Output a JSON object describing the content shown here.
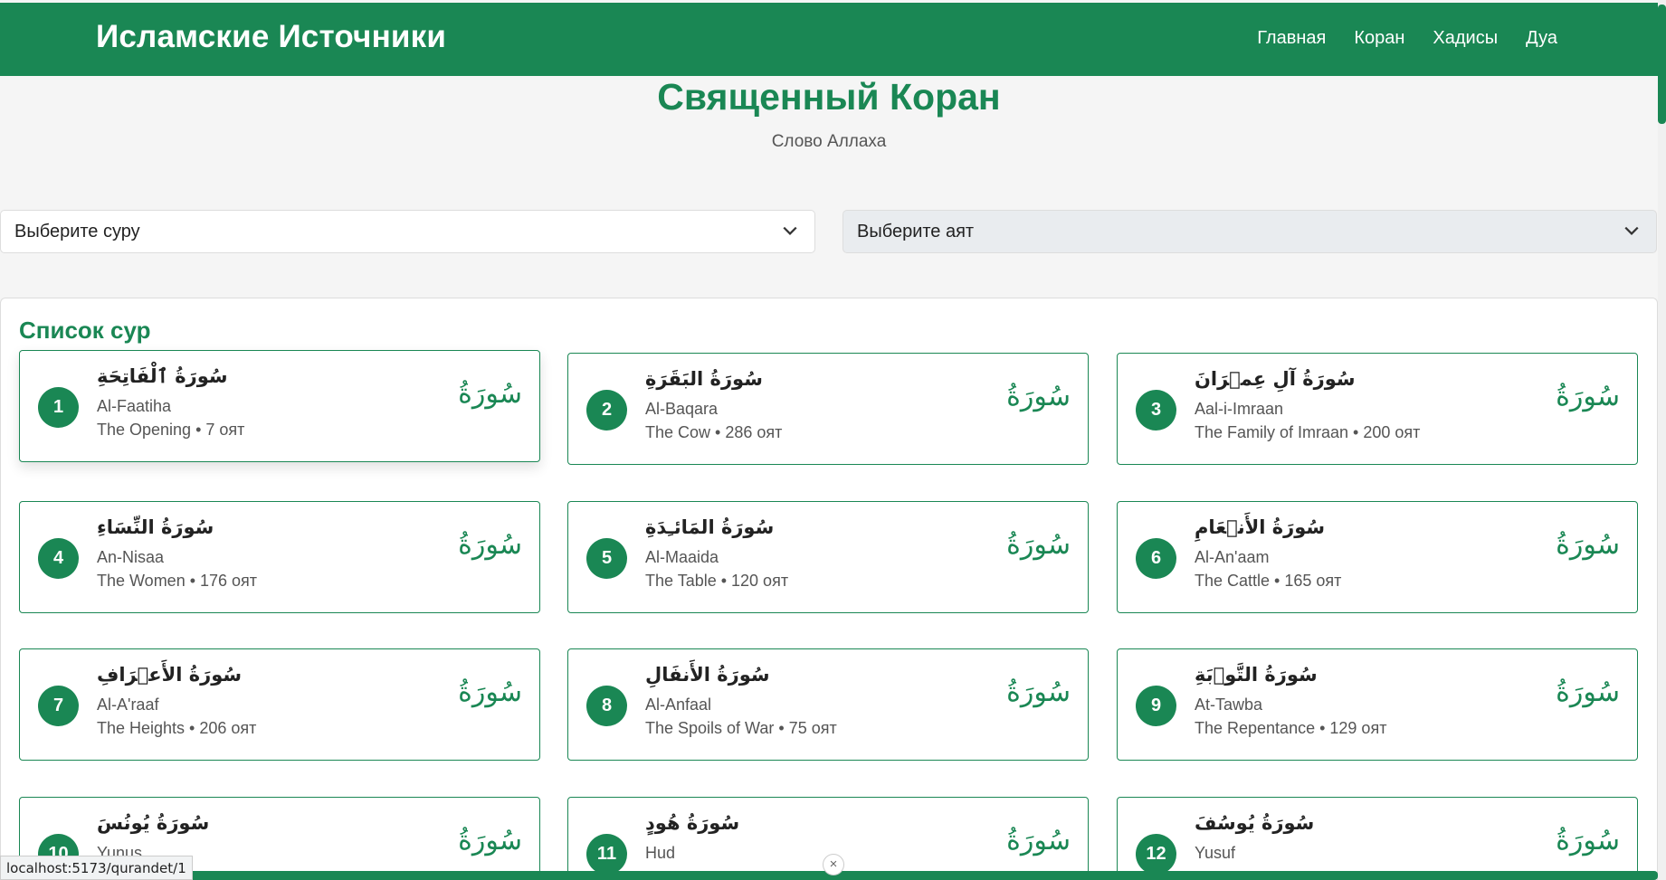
{
  "brand": "Исламские Источники",
  "nav": [
    "Главная",
    "Коран",
    "Хадисы",
    "Дуа"
  ],
  "page": {
    "title": "Священный Коран",
    "subtitle": "Слово Аллаха"
  },
  "selects": {
    "surah_placeholder": "Выберите суру",
    "ayah_placeholder": "Выберите аят"
  },
  "list_title": "Список сур",
  "sura_word": "سُورَةُ",
  "surahs": [
    {
      "number": "1",
      "arabic": "سُورَةُ ٱلْفَاتِحَةِ",
      "name": "Al-Faatiha",
      "meta": "The Opening • 7 оят"
    },
    {
      "number": "2",
      "arabic": "سُورَةُ البَقَرَةِ",
      "name": "Al-Baqara",
      "meta": "The Cow • 286 оят"
    },
    {
      "number": "3",
      "arabic": "سُورَةُ آلِ عِمۡرَانَ",
      "name": "Aal-i-Imraan",
      "meta": "The Family of Imraan • 200 оят"
    },
    {
      "number": "4",
      "arabic": "سُورَةُ النِّسَاءِ",
      "name": "An-Nisaa",
      "meta": "The Women • 176 оят"
    },
    {
      "number": "5",
      "arabic": "سُورَةُ المَائـِدَةِ",
      "name": "Al-Maaida",
      "meta": "The Table • 120 оят"
    },
    {
      "number": "6",
      "arabic": "سُورَةُ الأَنۡعَامِ",
      "name": "Al-An'aam",
      "meta": "The Cattle • 165 оят"
    },
    {
      "number": "7",
      "arabic": "سُورَةُ الأَعۡرَافِ",
      "name": "Al-A'raaf",
      "meta": "The Heights • 206 оят"
    },
    {
      "number": "8",
      "arabic": "سُورَةُ الأَنفَالِ",
      "name": "Al-Anfaal",
      "meta": "The Spoils of War • 75 оят"
    },
    {
      "number": "9",
      "arabic": "سُورَةُ التَّوۡبَةِ",
      "name": "At-Tawba",
      "meta": "The Repentance • 129 оят"
    },
    {
      "number": "10",
      "arabic": "سُورَةُ يُونُسَ",
      "name": "Yunus",
      "meta": ""
    },
    {
      "number": "11",
      "arabic": "سُورَةُ هُودٍ",
      "name": "Hud",
      "meta": ""
    },
    {
      "number": "12",
      "arabic": "سُورَةُ يُوسُفَ",
      "name": "Yusuf",
      "meta": ""
    }
  ],
  "status_url": "localhost:5173/qurandet/1",
  "close_symbol": "×"
}
